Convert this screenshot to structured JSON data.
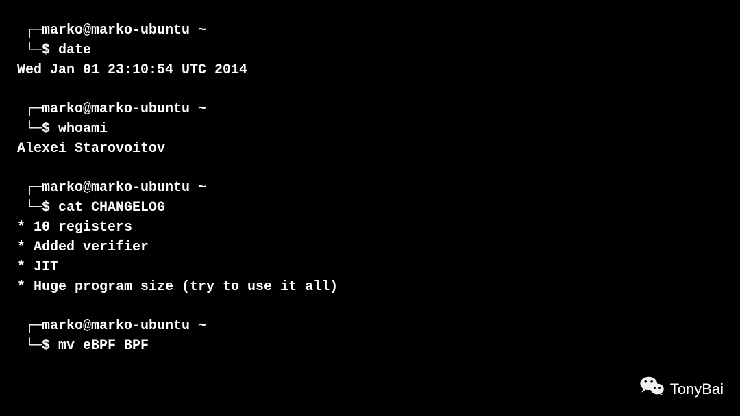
{
  "prompt": {
    "corner_tl": "┌─",
    "corner_bl": "└─",
    "user_host": "marko@marko-ubuntu",
    "path": "~",
    "symbol": "$"
  },
  "blocks": [
    {
      "command": "date",
      "output": [
        "Wed Jan 01 23:10:54 UTC 2014"
      ]
    },
    {
      "command": "whoami",
      "output": [
        "Alexei Starovoitov"
      ]
    },
    {
      "command": "cat CHANGELOG",
      "output": [
        "* 10 registers",
        "* Added verifier",
        "* JIT",
        "* Huge program size (try to use it all)"
      ]
    },
    {
      "command": "mv eBPF BPF",
      "output": []
    }
  ],
  "watermark": {
    "label": "TonyBai"
  }
}
